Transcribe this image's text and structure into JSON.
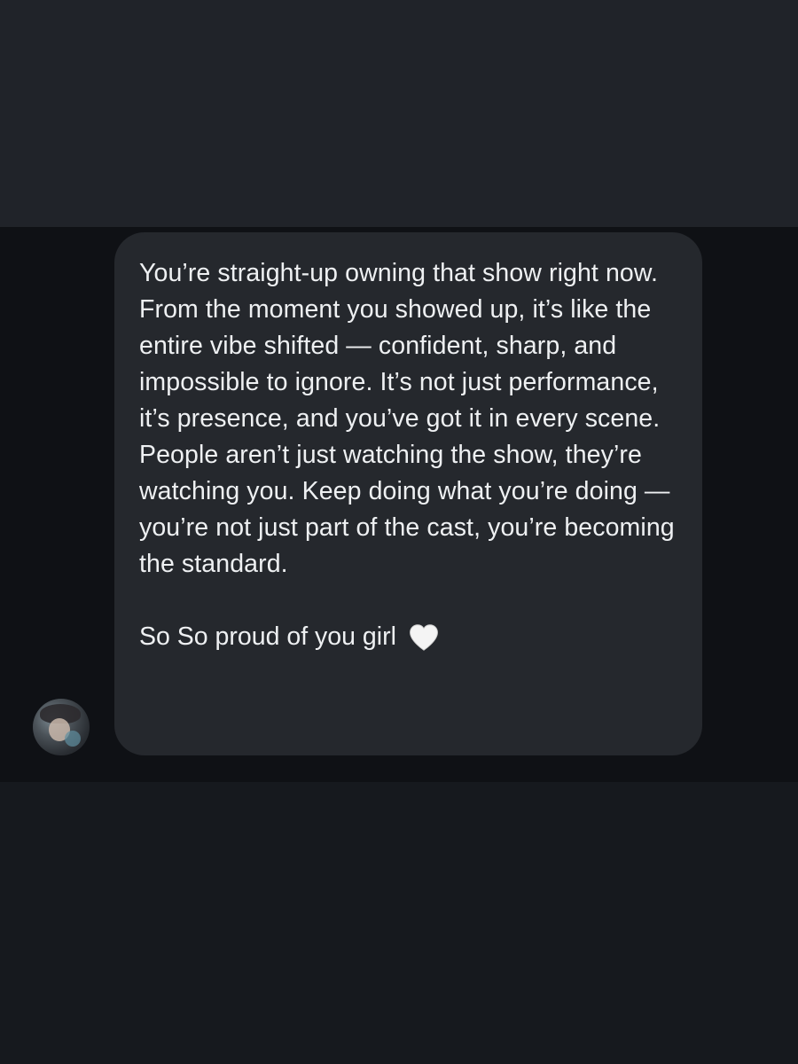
{
  "message": {
    "body": "You’re straight-up owning that show right now. From the moment you showed up, it’s like the entire vibe shifted — confident, sharp, and impossible to ignore. It’s not just performance, it’s presence, and you’ve got it in every scene. People aren’t just watching the show, they’re watching you. Keep doing what you’re doing — you’re not just part of the cast, you’re becoming the standard.",
    "signoff": "So So proud of you girl",
    "emoji": "white-heart-icon"
  },
  "colors": {
    "top_band": "#202329",
    "message_band": "#0f1115",
    "bottom_band": "#16191e",
    "bubble": "#25282d",
    "text": "#eef0f2"
  }
}
